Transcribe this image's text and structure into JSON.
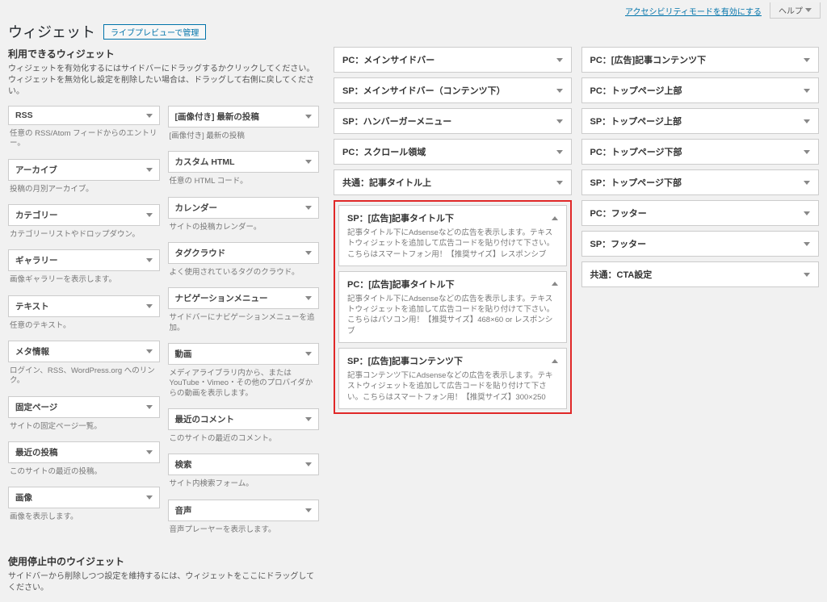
{
  "topbar": {
    "accessibility": "アクセシビリティモードを有効にする",
    "help": "ヘルプ"
  },
  "header": {
    "title": "ウィジェット",
    "preview": "ライブプレビューで管理"
  },
  "available": {
    "title": "利用できるウィジェット",
    "desc": "ウィジェットを有効化するにはサイドバーにドラッグするかクリックしてください。ウィジェットを無効化し設定を削除したい場合は、ドラッグして右側に戻してください。"
  },
  "widgets_left": [
    {
      "name": "RSS",
      "desc": "任意の RSS/Atom フィードからのエントリー。"
    },
    {
      "name": "アーカイブ",
      "desc": "投稿の月別アーカイブ。"
    },
    {
      "name": "カテゴリー",
      "desc": "カテゴリーリストやドロップダウン。"
    },
    {
      "name": "ギャラリー",
      "desc": "画像ギャラリーを表示します。"
    },
    {
      "name": "テキスト",
      "desc": "任意のテキスト。"
    },
    {
      "name": "メタ情報",
      "desc": "ログイン、RSS、WordPress.org へのリンク。"
    },
    {
      "name": "固定ページ",
      "desc": "サイトの固定ページ一覧。"
    },
    {
      "name": "最近の投稿",
      "desc": "このサイトの最近の投稿。"
    },
    {
      "name": "画像",
      "desc": "画像を表示します。"
    }
  ],
  "widgets_right": [
    {
      "name": "[画像付き] 最新の投稿",
      "desc": "[画像付き] 最新の投稿"
    },
    {
      "name": "カスタム HTML",
      "desc": "任意の HTML コード。"
    },
    {
      "name": "カレンダー",
      "desc": "サイトの投稿カレンダー。"
    },
    {
      "name": "タグクラウド",
      "desc": "よく使用されているタグのクラウド。"
    },
    {
      "name": "ナビゲーションメニュー",
      "desc": "サイドバーにナビゲーションメニューを追加。"
    },
    {
      "name": "動画",
      "desc": "メディアライブラリ内から、または YouTube・Vimeo・その他のプロバイダからの動画を表示します。"
    },
    {
      "name": "最近のコメント",
      "desc": "このサイトの最近のコメント。"
    },
    {
      "name": "検索",
      "desc": "サイト内検索フォーム。"
    },
    {
      "name": "音声",
      "desc": "音声プレーヤーを表示します。"
    }
  ],
  "inactive": {
    "title": "使用停止中のウイジェット",
    "desc": "サイドバーから削除しつつ設定を維持するには、ウィジェットをここにドラッグしてください。"
  },
  "areas_col1": [
    "PC：メインサイドバー",
    "SP：メインサイドバー（コンテンツ下）",
    "SP：ハンバーガーメニュー",
    "PC：スクロール領域",
    "共通：記事タイトル上"
  ],
  "highlighted": [
    {
      "title": "SP：[広告]記事タイトル下",
      "desc": "記事タイトル下にAdsenseなどの広告を表示します。テキストウィジェットを追加して広告コードを貼り付けて下さい。こちらはスマートフォン用！【推奨サイズ】レスポンシブ"
    },
    {
      "title": "PC：[広告]記事タイトル下",
      "desc": "記事タイトル下にAdsenseなどの広告を表示します。テキストウィジェットを追加して広告コードを貼り付けて下さい。こちらはパソコン用！【推奨サイズ】468×60 or レスポンシブ"
    },
    {
      "title": "SP：[広告]記事コンテンツ下",
      "desc": "記事コンテンツ下にAdsenseなどの広告を表示します。テキストウィジェットを追加して広告コードを貼り付けて下さい。こちらはスマートフォン用！【推奨サイズ】300×250"
    }
  ],
  "areas_col2": [
    "PC：[広告]記事コンテンツ下",
    "PC：トップページ上部",
    "SP：トップページ上部",
    "PC：トップページ下部",
    "SP：トップページ下部",
    "PC：フッター",
    "SP：フッター",
    "共通：CTA設定"
  ]
}
